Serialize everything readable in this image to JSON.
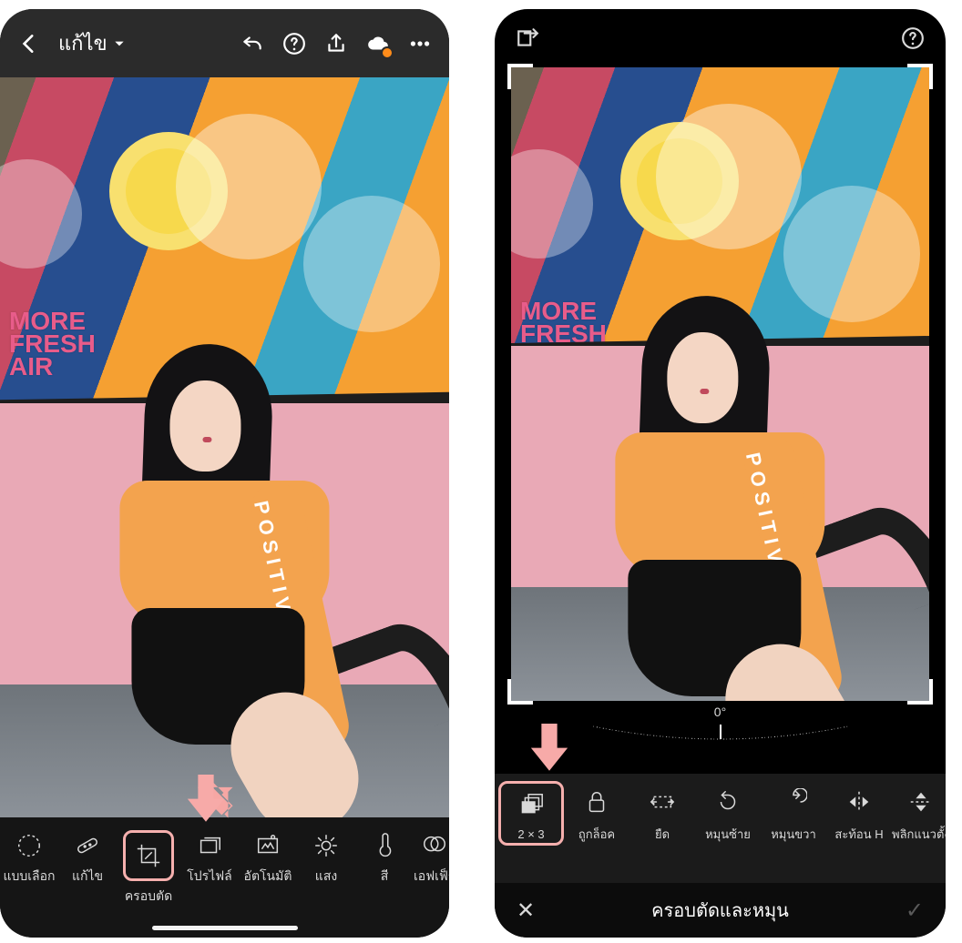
{
  "left": {
    "header_title": "แก้ไข",
    "icons": {
      "back": "back-icon",
      "dropdown": "chevron-down-icon",
      "undo": "undo-icon",
      "help": "help-icon",
      "share": "share-icon",
      "cloud": "cloud-warning-icon",
      "more": "more-icon"
    },
    "tools": [
      {
        "id": "select",
        "label": "แบบเลือก"
      },
      {
        "id": "edit",
        "label": "แก้ไข"
      },
      {
        "id": "crop",
        "label": "ครอบตัด",
        "selected": true
      },
      {
        "id": "profile",
        "label": "โปรไฟล์"
      },
      {
        "id": "auto",
        "label": "อัตโนมัติ"
      },
      {
        "id": "light",
        "label": "แสง"
      },
      {
        "id": "color",
        "label": "สี"
      },
      {
        "id": "effect",
        "label": "เอฟเฟ็ก"
      }
    ]
  },
  "right": {
    "icons": {
      "aspect": "aspect-icon",
      "help": "help-icon"
    },
    "angle_value": "0°",
    "tools": [
      {
        "id": "ratio",
        "label": "2 × 3",
        "selected": true
      },
      {
        "id": "locked",
        "label": "ถูกล็อค"
      },
      {
        "id": "stretch",
        "label": "ยืด"
      },
      {
        "id": "rotleft",
        "label": "หมุนซ้าย"
      },
      {
        "id": "rotright",
        "label": "หมุนขวา"
      },
      {
        "id": "fliph",
        "label": "สะท้อน H"
      },
      {
        "id": "flipv",
        "label": "พลิกแนวตั้ง"
      }
    ],
    "panel_title": "ครอบตัดและหมุน"
  },
  "image": {
    "sleeve_text": "POSITIVITY",
    "wall_text": "MORE\nFRESH\nAIR"
  },
  "colors": {
    "highlight": "#f6b0ae",
    "accent": "#ff8c1a"
  }
}
